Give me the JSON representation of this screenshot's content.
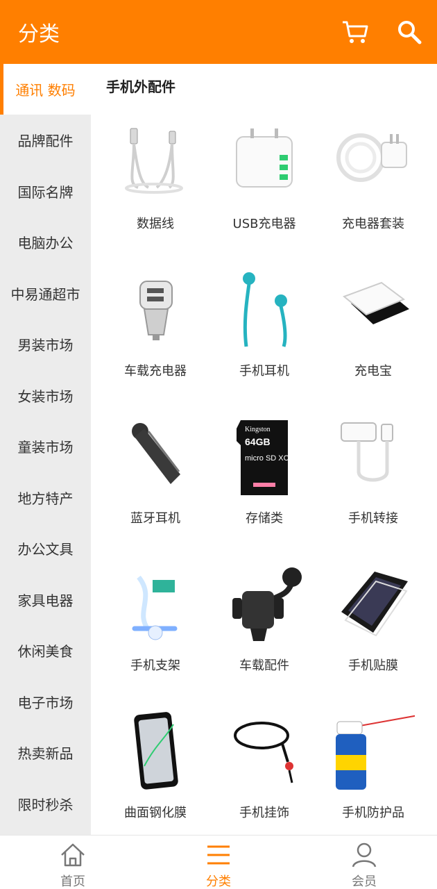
{
  "header": {
    "title": "分类",
    "cart_icon": "cart-icon",
    "search_icon": "search-icon"
  },
  "colors": {
    "accent": "#ff7f00",
    "sidebar_bg": "#ececec"
  },
  "sidebar": {
    "items": [
      {
        "label": "通讯 数码",
        "active": true
      },
      {
        "label": "品牌配件"
      },
      {
        "label": "国际名牌"
      },
      {
        "label": "电脑办公"
      },
      {
        "label": "中易通超市"
      },
      {
        "label": "男装市场"
      },
      {
        "label": "女装市场"
      },
      {
        "label": "童装市场"
      },
      {
        "label": "地方特产"
      },
      {
        "label": "办公文具"
      },
      {
        "label": "家具电器"
      },
      {
        "label": "休闲美食"
      },
      {
        "label": "电子市场"
      },
      {
        "label": "热卖新品"
      },
      {
        "label": "限时秒杀"
      }
    ]
  },
  "section": {
    "title": "手机外配件",
    "products": [
      {
        "label": "数据线",
        "icon": "data-cable-icon"
      },
      {
        "label": "USB充电器",
        "icon": "usb-charger-icon"
      },
      {
        "label": "充电器套装",
        "icon": "charger-set-icon"
      },
      {
        "label": "车载充电器",
        "icon": "car-charger-icon"
      },
      {
        "label": "手机耳机",
        "icon": "earphone-icon"
      },
      {
        "label": "充电宝",
        "icon": "power-bank-icon"
      },
      {
        "label": "蓝牙耳机",
        "icon": "bluetooth-headset-icon"
      },
      {
        "label": "存储类",
        "icon": "sd-card-icon",
        "card_brand": "Kingston",
        "card_capacity": "64GB",
        "card_type": "micro SD XC"
      },
      {
        "label": "手机转接",
        "icon": "adapter-icon"
      },
      {
        "label": "手机支架",
        "icon": "phone-stand-icon"
      },
      {
        "label": "车载配件",
        "icon": "car-mount-icon"
      },
      {
        "label": "手机贴膜",
        "icon": "screen-protector-icon"
      },
      {
        "label": "曲面钢化膜",
        "icon": "curved-glass-icon"
      },
      {
        "label": "手机挂饰",
        "icon": "lanyard-icon"
      },
      {
        "label": "手机防护品",
        "icon": "spray-can-icon"
      }
    ]
  },
  "tabbar": {
    "tabs": [
      {
        "label": "首页",
        "icon": "home-icon"
      },
      {
        "label": "分类",
        "icon": "list-icon",
        "active": true
      },
      {
        "label": "会员",
        "icon": "user-icon"
      }
    ]
  }
}
